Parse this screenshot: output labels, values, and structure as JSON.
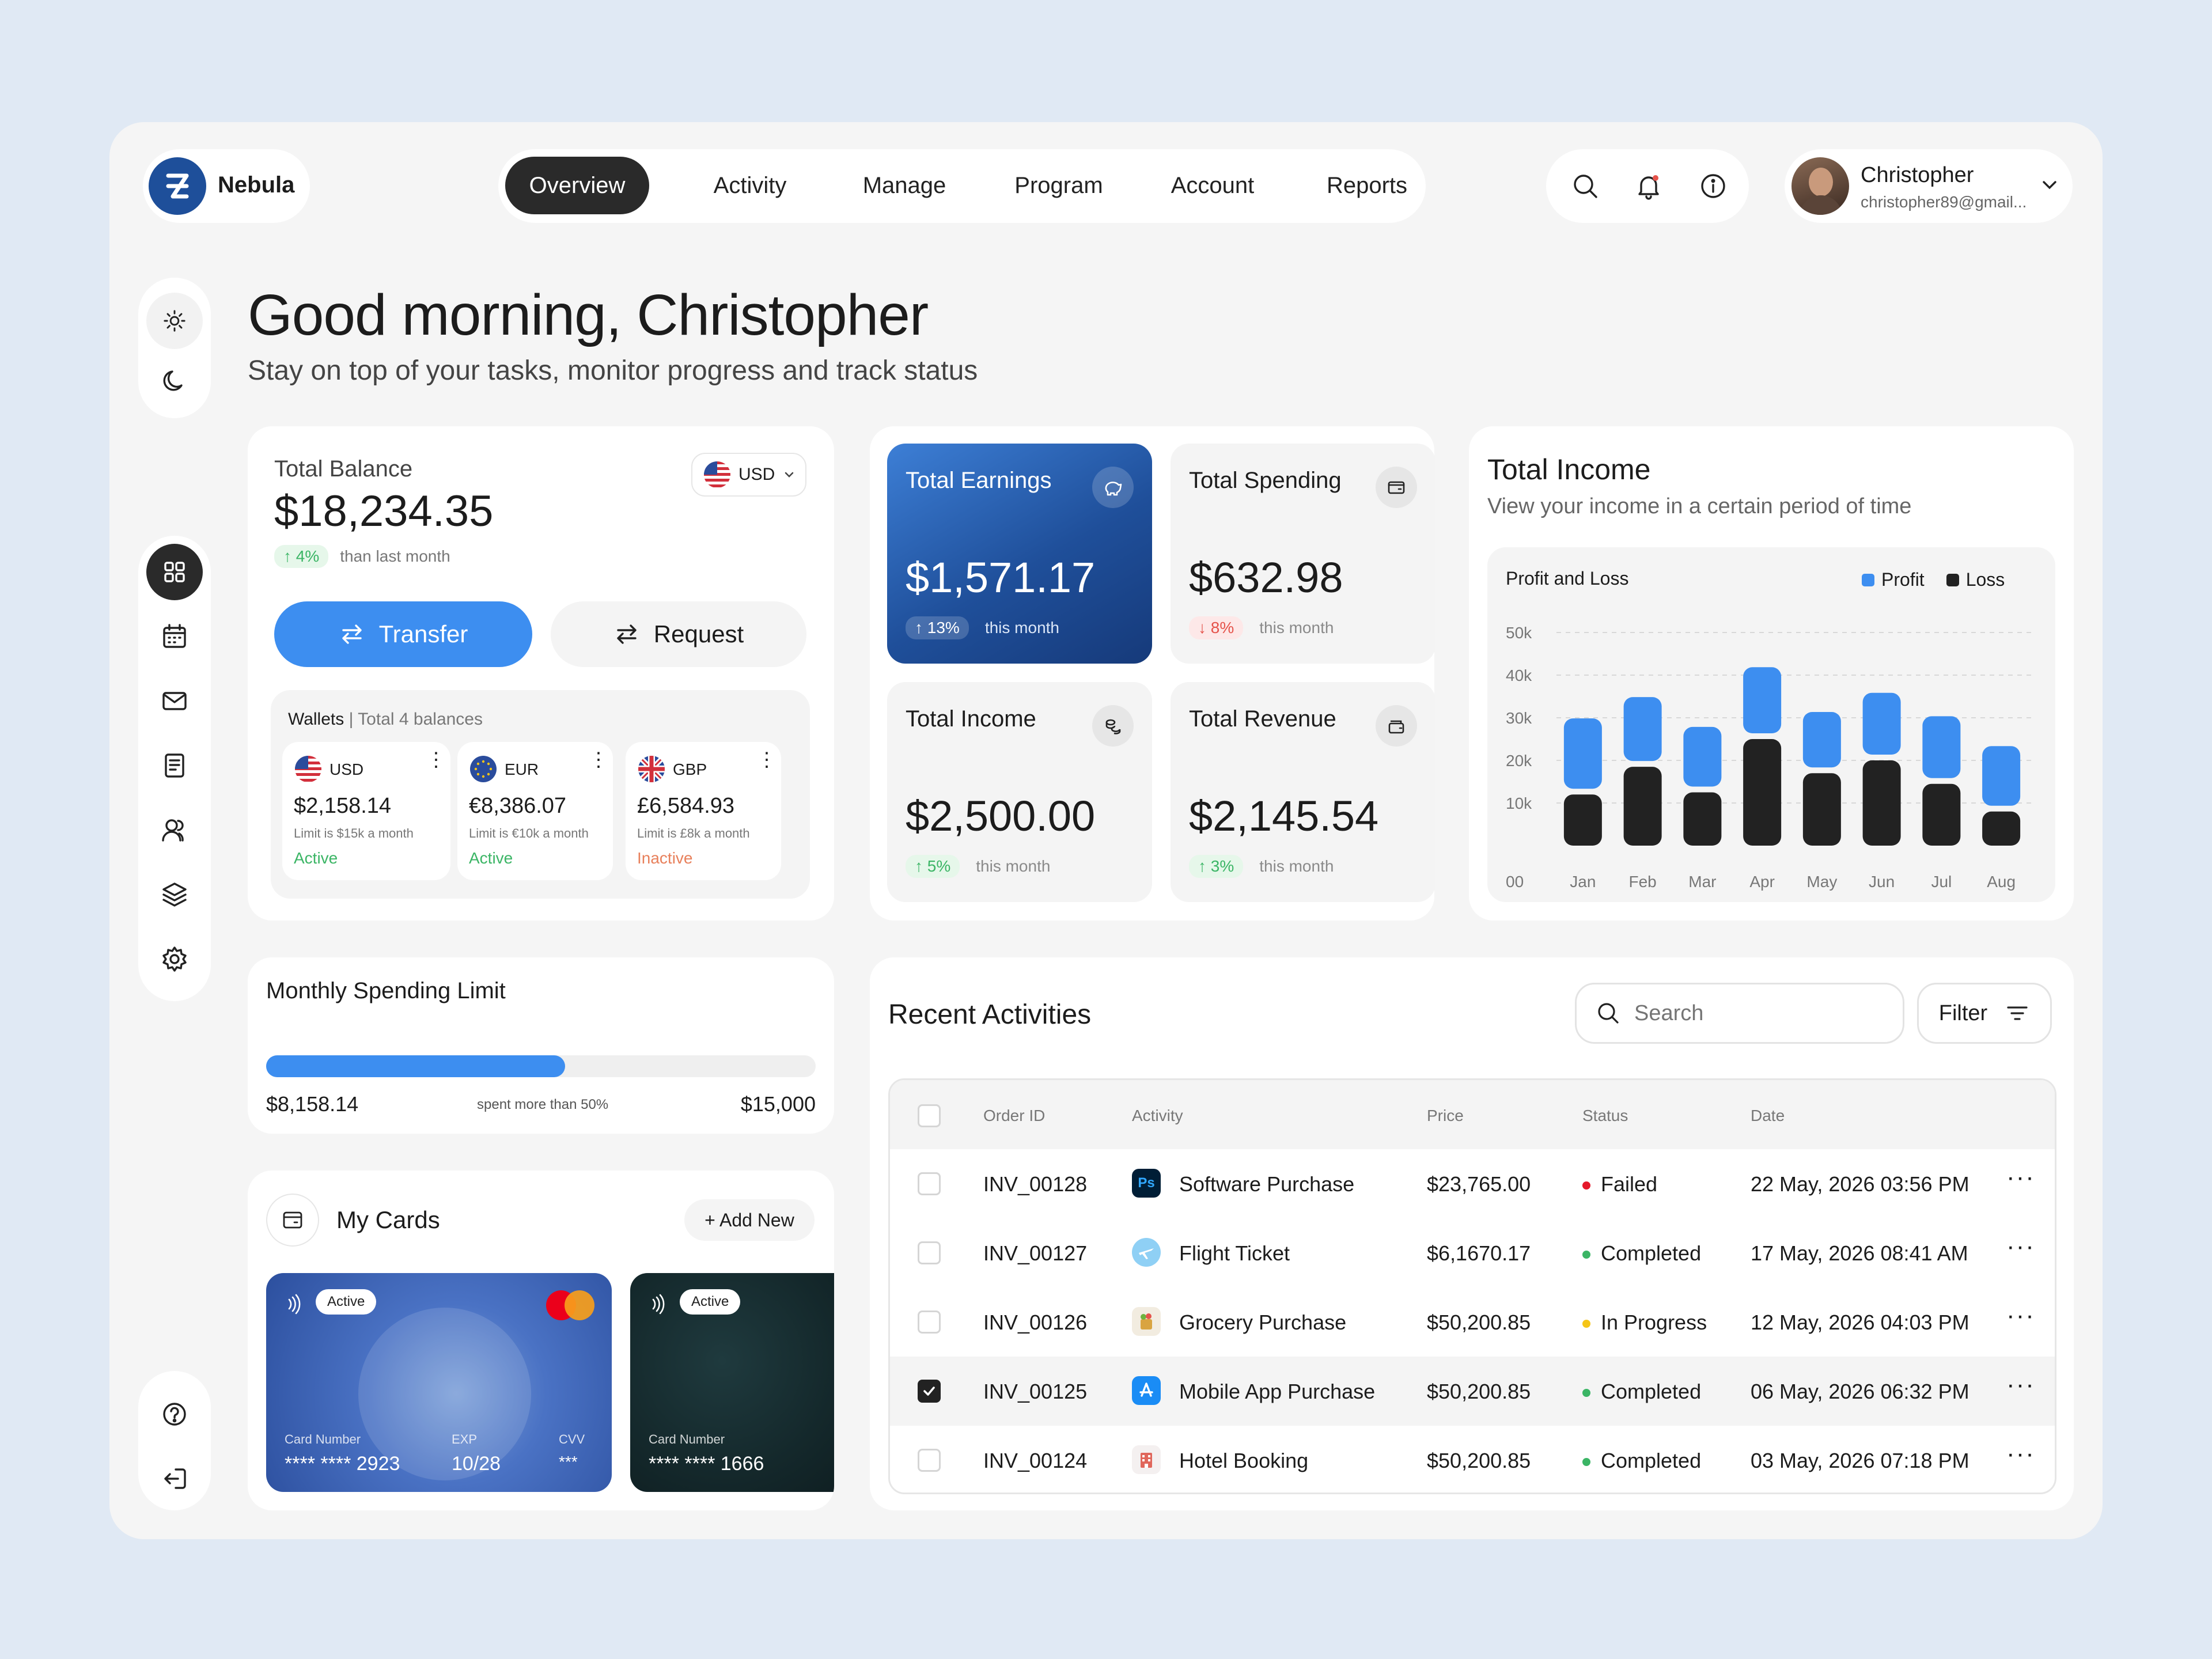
{
  "brand": {
    "name": "Nebula"
  },
  "nav": {
    "tabs": [
      "Overview",
      "Activity",
      "Manage",
      "Program",
      "Account",
      "Reports"
    ]
  },
  "user": {
    "name": "Christopher",
    "email": "christopher89@gmail..."
  },
  "greeting": {
    "title": "Good morning, Christopher",
    "subtitle": "Stay on top of your tasks, monitor progress and track status"
  },
  "balance": {
    "label": "Total Balance",
    "amount": "$18,234.35",
    "currency": "USD",
    "change": "↑ 4%",
    "change_note": "than last month",
    "transfer_label": "Transfer",
    "request_label": "Request",
    "wallets_title": "Wallets",
    "wallets_note": "| Total 4 balances",
    "wallets": [
      {
        "code": "USD",
        "amount": "$2,158.14",
        "limit": "Limit is $15k a month",
        "status": "Active"
      },
      {
        "code": "EUR",
        "amount": "€8,386.07",
        "limit": "Limit is €10k a month",
        "status": "Active"
      },
      {
        "code": "GBP",
        "amount": "£6,584.93",
        "limit": "Limit is £8k a month",
        "status": "Inactive"
      }
    ]
  },
  "stats": [
    {
      "title": "Total Earnings",
      "value": "$1,571.17",
      "change": "↑ 13%",
      "note": "this month"
    },
    {
      "title": "Total Spending",
      "value": "$632.98",
      "change": "↓ 8%",
      "note": "this month"
    },
    {
      "title": "Total Income",
      "value": "$2,500.00",
      "change": "↑ 5%",
      "note": "this month"
    },
    {
      "title": "Total Revenue",
      "value": "$2,145.54",
      "change": "↑ 3%",
      "note": "this month"
    }
  ],
  "income": {
    "title": "Total Income",
    "subtitle": "View your income in a certain period of time"
  },
  "chart_data": {
    "type": "bar",
    "title": "Profit and Loss",
    "categories": [
      "Jan",
      "Feb",
      "Mar",
      "Apr",
      "May",
      "Jun",
      "Jul",
      "Aug"
    ],
    "series": [
      {
        "name": "Loss",
        "values": [
          12,
          18.5,
          12.5,
          25,
          17,
          20,
          14.5,
          8
        ]
      },
      {
        "name": "Profit",
        "values": [
          16.5,
          15,
          14,
          15.5,
          13,
          14.5,
          14.5,
          14
        ]
      }
    ],
    "yticks": [
      "00",
      "10k",
      "20k",
      "30k",
      "40k",
      "50k"
    ],
    "ylim": [
      0,
      50
    ],
    "stacked": true,
    "legend": "top-right",
    "colors": {
      "Profit": "#3d8ef0",
      "Loss": "#222222"
    }
  },
  "spending": {
    "title": "Monthly Spending Limit",
    "spent": "$8,158.14",
    "note": "spent more than 50%",
    "limit": "$15,000",
    "fraction": 0.544
  },
  "cards": {
    "title": "My Cards",
    "add_label": "+ Add New",
    "items": [
      {
        "status": "Active",
        "number_label": "Card Number",
        "number": "**** **** 2923",
        "exp_label": "EXP",
        "exp": "10/28",
        "cvv_label": "CVV",
        "cvv": "***"
      },
      {
        "status": "Active",
        "number_label": "Card Number",
        "number": "**** **** 1666"
      }
    ]
  },
  "activities": {
    "title": "Recent Activities",
    "search_placeholder": "Search",
    "filter_label": "Filter",
    "columns": [
      "Order ID",
      "Activity",
      "Price",
      "Status",
      "Date"
    ],
    "rows": [
      {
        "id": "INV_00128",
        "activity": "Software Purchase",
        "price": "$23,765.00",
        "status": "Failed",
        "date": "22 May, 2026 03:56 PM",
        "icon": "photoshop-icon",
        "checked": false
      },
      {
        "id": "INV_00127",
        "activity": "Flight Ticket",
        "price": "$6,1670.17",
        "status": "Completed",
        "date": "17 May, 2026 08:41 AM",
        "icon": "plane-icon",
        "checked": false
      },
      {
        "id": "INV_00126",
        "activity": "Grocery Purchase",
        "price": "$50,200.85",
        "status": "In Progress",
        "date": "12 May, 2026 04:03 PM",
        "icon": "grocery-icon",
        "checked": false
      },
      {
        "id": "INV_00125",
        "activity": "Mobile App Purchase",
        "price": "$50,200.85",
        "status": "Completed",
        "date": "06 May, 2026 06:32 PM",
        "icon": "app-store-icon",
        "checked": true
      },
      {
        "id": "INV_00124",
        "activity": "Hotel Booking",
        "price": "$50,200.85",
        "status": "Completed",
        "date": "03 May, 2026 07:18 PM",
        "icon": "hotel-icon",
        "checked": false
      }
    ]
  },
  "colors": {
    "accent": "#3d8ef0",
    "dark": "#222222",
    "success": "#3bb565",
    "danger": "#e5534b",
    "warning": "#f5c518"
  }
}
